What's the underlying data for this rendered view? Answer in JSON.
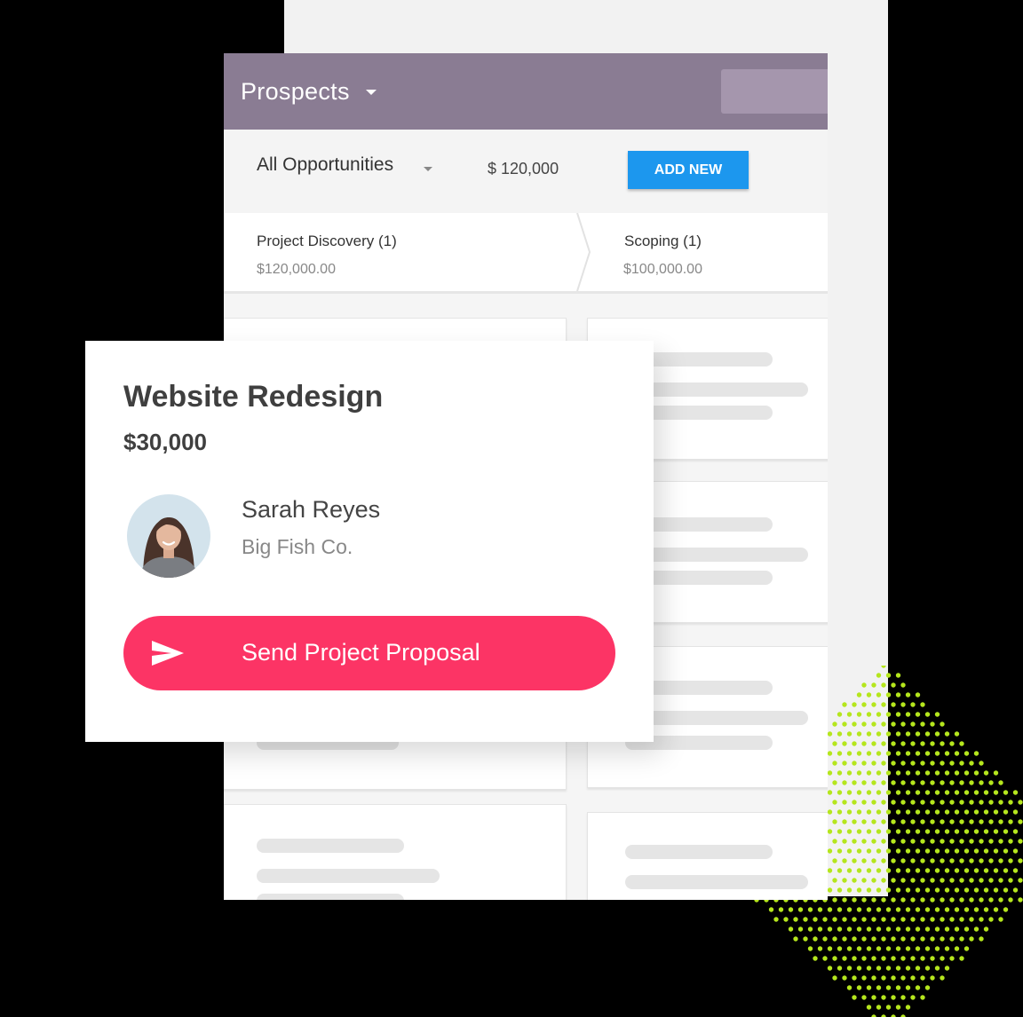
{
  "app": {
    "title": "Prospects",
    "colors": {
      "appbar": "#8a7c93",
      "accent_button": "#1c97ee",
      "send_button": "#fc3465",
      "dots": "#b5e61d"
    }
  },
  "toolbar": {
    "filter_label": "All Opportunities",
    "total": "$ 120,000",
    "add_new_label": "ADD NEW"
  },
  "stages": [
    {
      "name": "Project Discovery (1)",
      "amount": "$120,000.00"
    },
    {
      "name": "Scoping (1)",
      "amount": "$100,000.00"
    }
  ],
  "deal": {
    "title": "Website Redesign",
    "value": "$30,000",
    "contact": {
      "name": "Sarah Reyes",
      "company": "Big Fish Co."
    },
    "action_label": "Send Project Proposal",
    "action_icon": "send-icon"
  }
}
